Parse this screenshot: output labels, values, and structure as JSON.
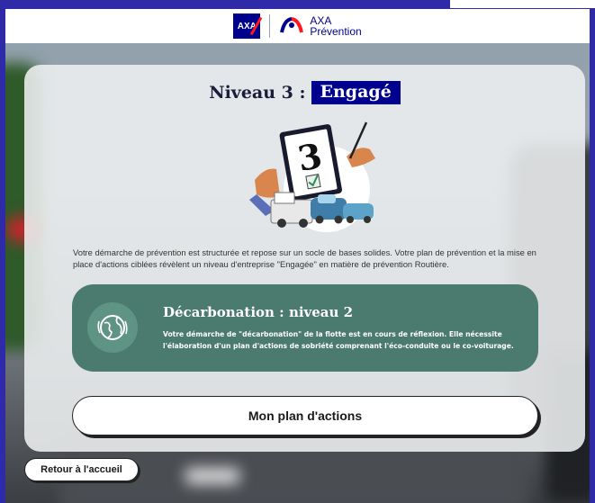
{
  "header": {
    "logo_text": "AXA",
    "brand_line1": "AXA",
    "brand_line2": "Prévention"
  },
  "card": {
    "level_prefix": "Niveau 3 :",
    "level_badge": "Engagé",
    "illustration_number": "3",
    "description": "Votre démarche de prévention est structurée et repose sur un socle de bases solides. Votre plan de prévention et la mise en place d'actions ciblées révèlent un niveau d'entreprise \"Engagée\" en matière de prévention Routière."
  },
  "decarbonation": {
    "title": "Décarbonation : niveau 2",
    "text": "Votre démarche de \"décarbonation\" de la flotte est en cours de réflexion. Elle nécessite l'élaboration d'un plan d'actions de sobriété comprenant l'éco-conduite ou le co-voiturage."
  },
  "actions": {
    "plan_button": "Mon plan d'actions",
    "home_button": "Retour à l'accueil"
  },
  "colors": {
    "brand_blue": "#00008f",
    "accent_red": "#ff1721",
    "decarbo_green": "#4b7a6e"
  },
  "icons": [
    "axa-logo-icon",
    "prevention-logo-icon",
    "clipboard-illustration-icon",
    "eco-globe-icon"
  ]
}
